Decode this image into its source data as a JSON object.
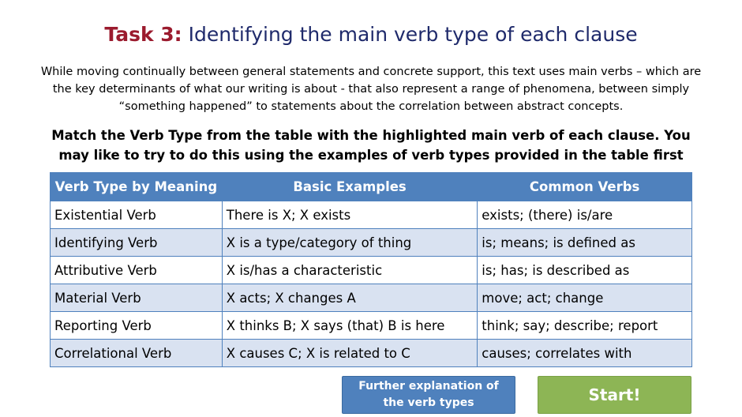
{
  "title": {
    "task_label": "Task 3:",
    "heading": "Identifying the main verb type of each clause"
  },
  "intro": "While moving continually between general statements and concrete support,  this text uses main verbs – which are the key determinants of what our writing is about - that also represent a range of phenomena, between simply “something happened” to statements about the correlation between abstract concepts.",
  "instruction": "Match the Verb Type from the table with the highlighted main verb of each clause. You may like to try to do this using the examples of verb types provided in the table first",
  "table": {
    "headers": [
      "Verb Type by Meaning",
      "Basic Examples",
      "Common Verbs"
    ],
    "rows": [
      [
        "Existential Verb",
        "There is X; X exists",
        "exists; (there) is/are"
      ],
      [
        "Identifying Verb",
        "X is a type/category of thing",
        "is; means; is defined as"
      ],
      [
        "Attributive Verb",
        "X is/has a characteristic",
        "is; has; is described as"
      ],
      [
        "Material Verb",
        "X acts; X changes A",
        "move; act; change"
      ],
      [
        "Reporting Verb",
        "X thinks B;  X says (that) B is here",
        "think; say; describe; report"
      ],
      [
        "Correlational Verb",
        "X causes C; X is related to C",
        "causes; correlates with"
      ]
    ]
  },
  "buttons": {
    "explain": "Further explanation of the verb types",
    "start": "Start!"
  },
  "colors": {
    "task_label": "#9b1b2e",
    "heading": "#1f2a6b",
    "table_header": "#4f81bd",
    "table_band": "#d9e2f1",
    "start_button": "#8db555"
  }
}
